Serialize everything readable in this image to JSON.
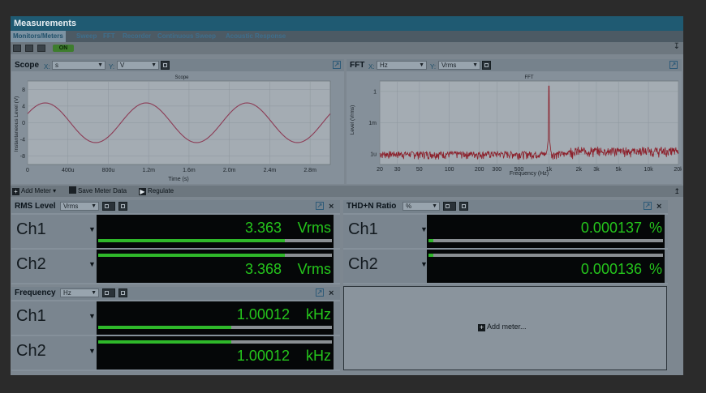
{
  "window": {
    "title": "Measurements"
  },
  "tabs": [
    {
      "label": "Monitors/Meters",
      "active": true
    },
    {
      "label": "Sweep"
    },
    {
      "label": "FFT"
    },
    {
      "label": "Recorder"
    },
    {
      "label": "Continuous Sweep"
    },
    {
      "label": "Acoustic Response"
    }
  ],
  "toolbar": {
    "on_label": "ON"
  },
  "scope": {
    "title": "Scope",
    "x_label": "X:",
    "x_unit": "s",
    "y_label": "Y:",
    "y_unit": "V",
    "chart_title": "Scope",
    "xaxis_label": "Time (s)",
    "yaxis_label": "Instantaneous Level (V)"
  },
  "fft": {
    "title": "FFT",
    "x_label": "X:",
    "x_unit": "Hz",
    "y_label": "Y:",
    "y_unit": "Vrms",
    "chart_title": "FFT",
    "xaxis_label": "Frequency (Hz)",
    "yaxis_label": "Level (Vrms)"
  },
  "chart_data": [
    {
      "type": "line",
      "title": "Scope",
      "xlabel": "Time (s)",
      "ylabel": "Instantaneous Level (V)",
      "xlim": [
        0,
        0.003
      ],
      "ylim": [
        -10,
        10
      ],
      "x_ticks": [
        "0",
        "400u",
        "800u",
        "1.2m",
        "1.6m",
        "2.0m",
        "2.4m",
        "2.8m"
      ],
      "y_ticks": [
        "8",
        "4",
        "0",
        "-4",
        "-8"
      ],
      "series": [
        {
          "color": "#8c3b55",
          "waveform": "sine",
          "amplitude": 4.75,
          "frequency_hz": 1000.12
        }
      ],
      "grid": true
    },
    {
      "type": "line",
      "title": "FFT",
      "xlabel": "Frequency (Hz)",
      "ylabel": "Level (Vrms)",
      "x_scale": "log",
      "y_scale": "log",
      "xlim": [
        20,
        20000
      ],
      "ylim": [
        1e-07,
        10
      ],
      "x_ticks": [
        "20",
        "30",
        "50",
        "100",
        "200",
        "300",
        "500",
        "1k",
        "2k",
        "3k",
        "5k",
        "10k",
        "20k"
      ],
      "y_ticks": [
        "1",
        "1m",
        "1u"
      ],
      "series": [
        {
          "color": "#8c1f2a",
          "peak_freq_hz": 1000,
          "peak_level_vrms": 3.36
        }
      ],
      "grid": true
    }
  ],
  "actions": {
    "add_meter": "Add Meter",
    "save_meter_data": "Save Meter Data",
    "regulate": "Regulate"
  },
  "rms": {
    "title": "RMS Level",
    "unit": "Vrms",
    "channels": [
      {
        "name": "Ch1",
        "value": "3.363",
        "unit": "Vrms",
        "fill": 0.8
      },
      {
        "name": "Ch2",
        "value": "3.368",
        "unit": "Vrms",
        "fill": 0.8
      }
    ]
  },
  "thd": {
    "title": "THD+N Ratio",
    "unit": "%",
    "channels": [
      {
        "name": "Ch1",
        "value": "0.000137",
        "unit": "%",
        "fill": 0.02
      },
      {
        "name": "Ch2",
        "value": "0.000136",
        "unit": "%",
        "fill": 0.02
      }
    ]
  },
  "frequency": {
    "title": "Frequency",
    "unit": "Hz",
    "channels": [
      {
        "name": "Ch1",
        "value": "1.00012",
        "unit": "kHz",
        "fill": 0.57
      },
      {
        "name": "Ch2",
        "value": "1.00012",
        "unit": "kHz",
        "fill": 0.57
      }
    ]
  },
  "add_meter_panel": {
    "label": "Add meter..."
  }
}
